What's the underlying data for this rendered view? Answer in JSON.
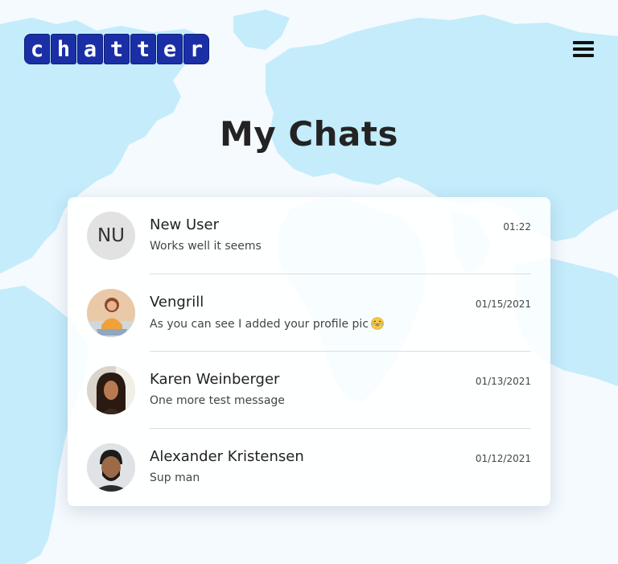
{
  "app": {
    "logo_letters": [
      "C",
      "H",
      "A",
      "T",
      "T",
      "E",
      "R"
    ]
  },
  "page": {
    "title": "My Chats"
  },
  "chats": [
    {
      "name": "New User",
      "preview": "Works well it seems",
      "time": "01:22",
      "initials": "NU"
    },
    {
      "name": "Vengrill",
      "preview": "As you can see I added your profile pic",
      "time": "01/15/2021",
      "emoji": "laughing-emoji"
    },
    {
      "name": "Karen Weinberger",
      "preview": "One more test message",
      "time": "01/13/2021"
    },
    {
      "name": "Alexander Kristensen",
      "preview": "Sup man",
      "time": "01/12/2021"
    }
  ],
  "colors": {
    "logo_tile": "#1a2fa6",
    "map_land": "#c4ecfb",
    "background": "#f4fafe",
    "card": "#ffffff"
  },
  "icons": {
    "menu": "hamburger-menu-icon"
  }
}
